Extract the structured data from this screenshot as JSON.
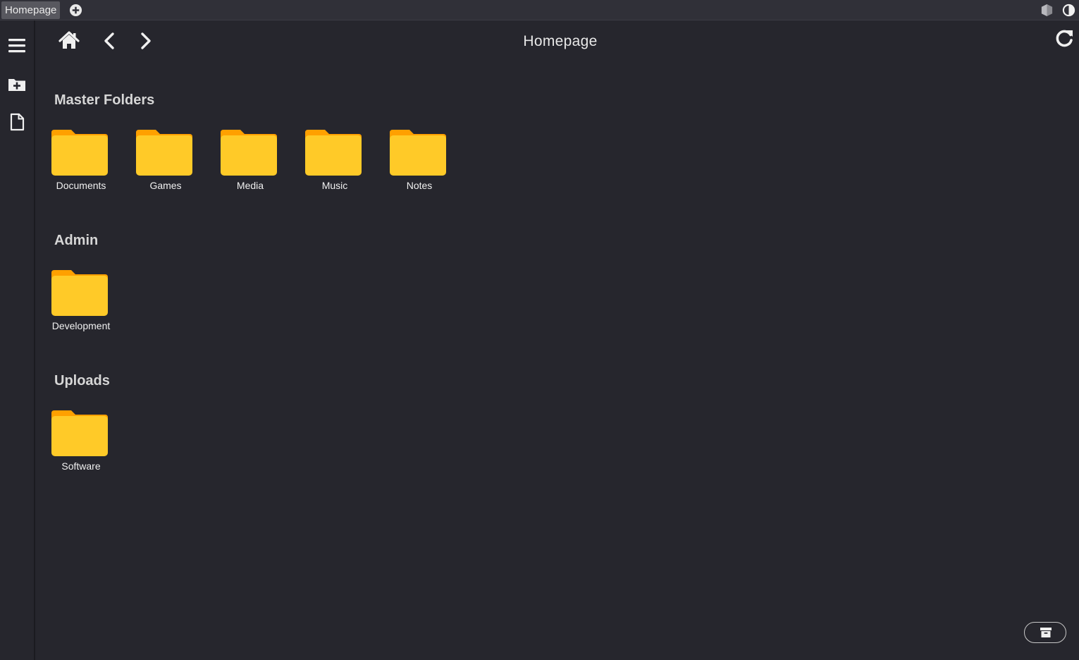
{
  "tabbar": {
    "tab_label": "Homepage",
    "add_tab_icon": "plus-circle-icon",
    "contrast_icon_1": "theme-toggle-icon",
    "contrast_icon_2": "contrast-icon"
  },
  "sidebar": {
    "items": [
      {
        "icon": "menu-icon"
      },
      {
        "icon": "new-folder-icon"
      },
      {
        "icon": "file-icon"
      }
    ]
  },
  "toolbar": {
    "home_icon": "home-icon",
    "back_icon": "chevron-left-icon",
    "forward_icon": "chevron-right-icon",
    "title": "Homepage",
    "refresh_icon": "refresh-icon"
  },
  "sections": [
    {
      "title": "Master Folders",
      "folders": [
        "Documents",
        "Games",
        "Media",
        "Music",
        "Notes"
      ]
    },
    {
      "title": "Admin",
      "folders": [
        "Development"
      ]
    },
    {
      "title": "Uploads",
      "folders": [
        "Software"
      ]
    }
  ],
  "footer": {
    "archive_icon": "archive-icon"
  },
  "colors": {
    "background": "#26262d",
    "folder_back": "#ffa000",
    "folder_front": "#ffca28",
    "text": "#e6e6e6"
  }
}
